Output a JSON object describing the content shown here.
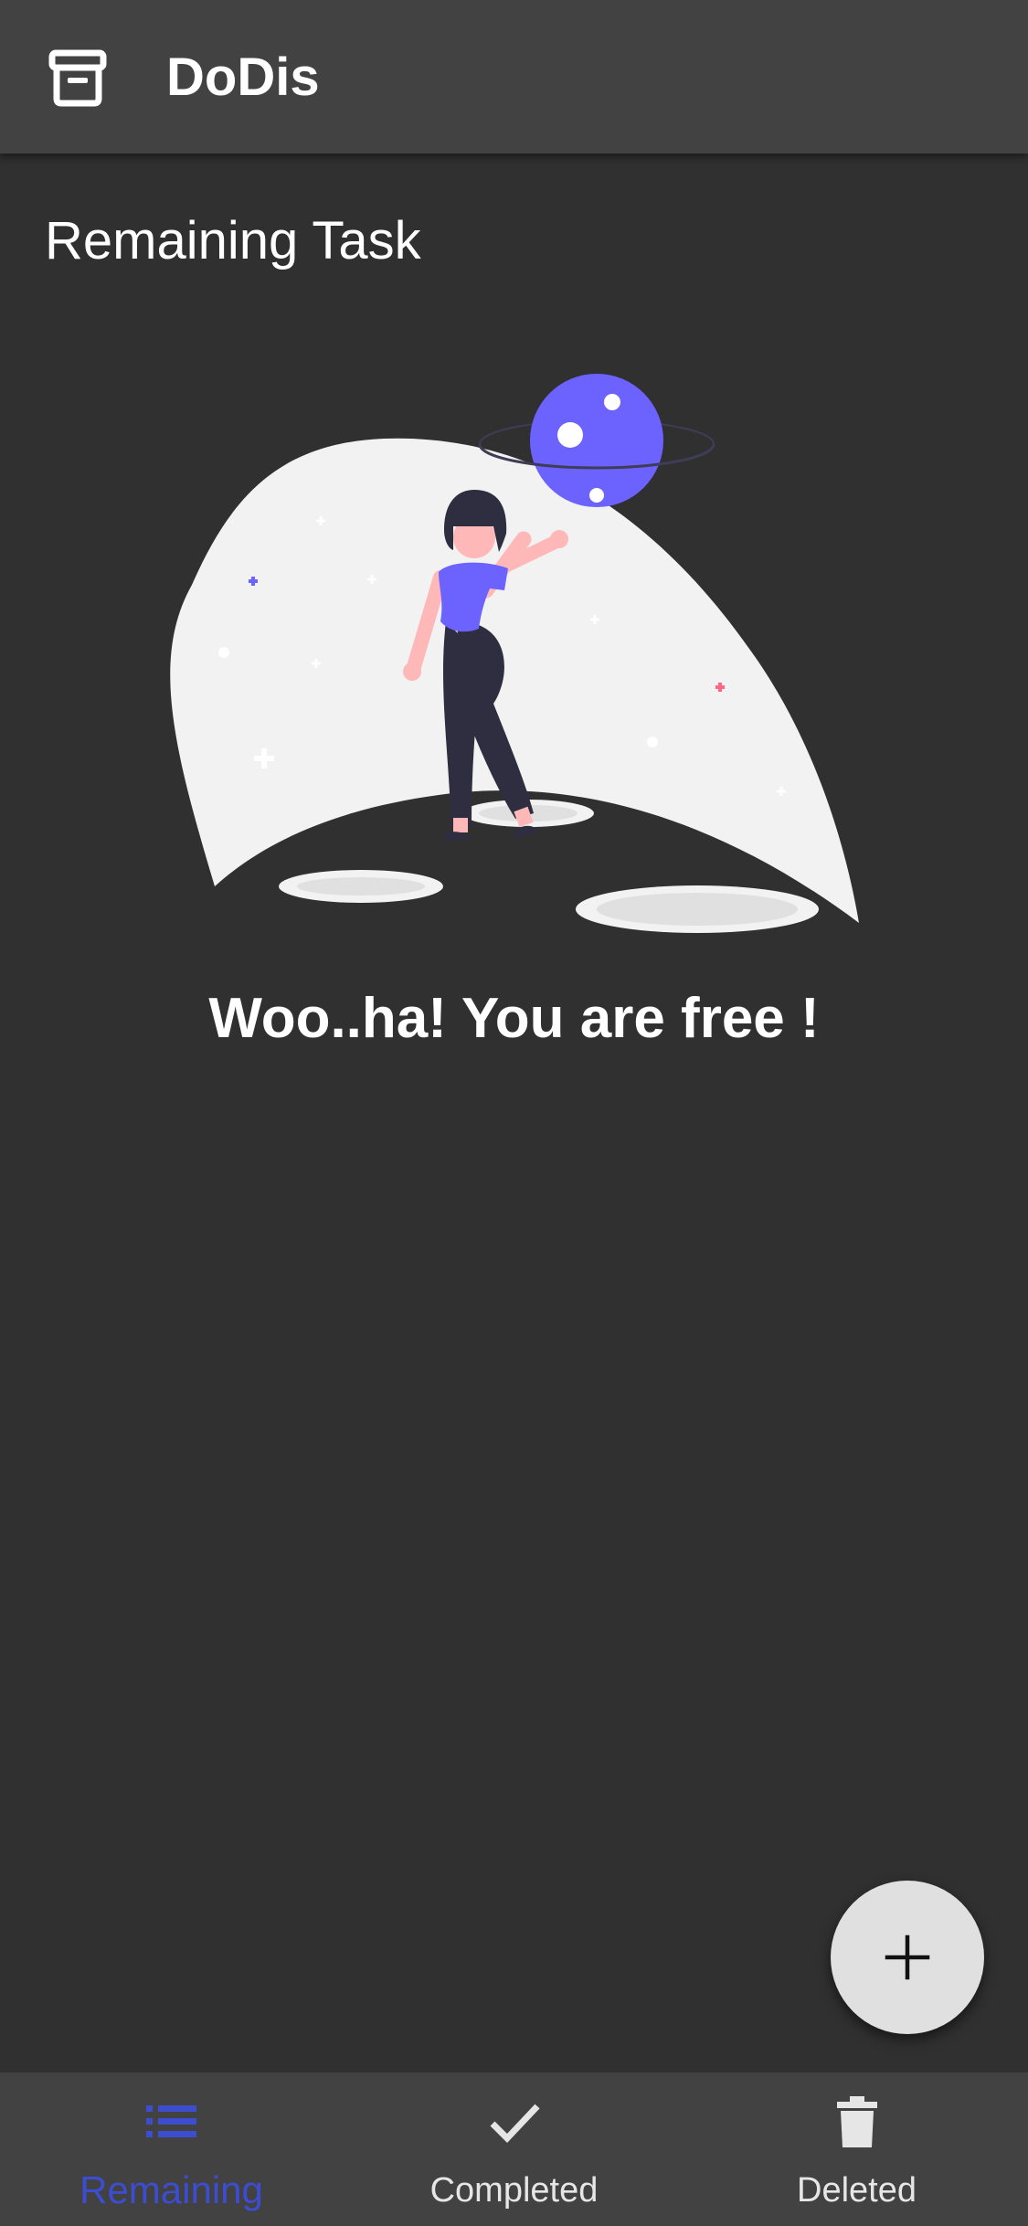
{
  "app_bar": {
    "title": "DoDis",
    "logo_icon": "archive-box-icon"
  },
  "main": {
    "section_title": "Remaining Task",
    "illustration": "woman-on-moon-with-planet-illustration",
    "empty_message": "Woo..ha! You are free !"
  },
  "fab": {
    "icon": "plus-icon"
  },
  "bottom_nav": {
    "items": [
      {
        "label": "Remaining",
        "icon": "list-icon",
        "active": true
      },
      {
        "label": "Completed",
        "icon": "check-icon",
        "active": false
      },
      {
        "label": "Deleted",
        "icon": "trash-icon",
        "active": false
      }
    ]
  },
  "colors": {
    "background": "#303030",
    "app_bar": "#424242",
    "accent": "#3d4dd0",
    "illustration_purple": "#6c63ff",
    "fab": "#e0e0e0"
  }
}
